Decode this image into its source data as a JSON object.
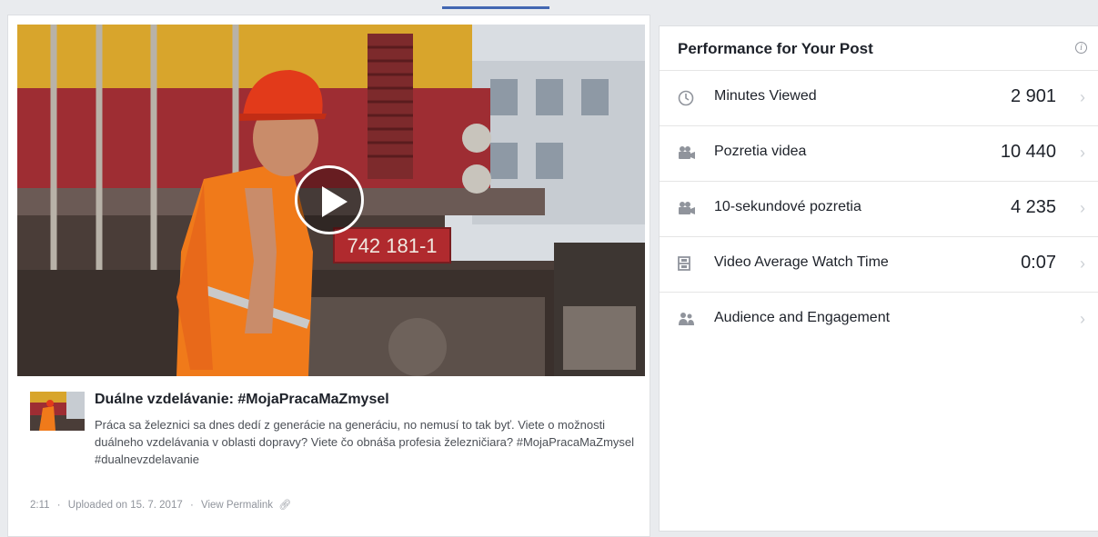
{
  "video": {
    "title": "Duálne vzdelávanie: #MojaPracaMaZmysel",
    "description": "Práca sa železnici sa dnes dedí z generácie na generáciu, no nemusí to tak byť. Viete o možnosti duálneho vzdelávania v oblasti dopravy? Viete čo obnáša profesia železničiara? #MojaPracaMaZmysel #dualnevzdelavanie",
    "duration": "2:11",
    "uploaded": "Uploaded on 15. 7. 2017",
    "permalink_label": "View Permalink",
    "locomotive_number": "742 181-1"
  },
  "performance": {
    "title": "Performance for Your Post",
    "metrics": [
      {
        "label": "Minutes Viewed",
        "value": "2 901",
        "icon": "clock-icon"
      },
      {
        "label": "Pozretia videa",
        "value": "10 440",
        "icon": "video-camera-icon"
      },
      {
        "label": "10-sekundové pozretia",
        "value": "4 235",
        "icon": "video-camera-icon"
      },
      {
        "label": "Video Average Watch Time",
        "value": "0:07",
        "icon": "film-icon"
      },
      {
        "label": "Audience and Engagement",
        "value": "",
        "icon": "people-icon"
      }
    ]
  },
  "colors": {
    "page_bg": "#e9ebee",
    "accent": "#4267b2",
    "worker_orange": "#f07a1a",
    "helmet_red": "#e23a1a"
  }
}
